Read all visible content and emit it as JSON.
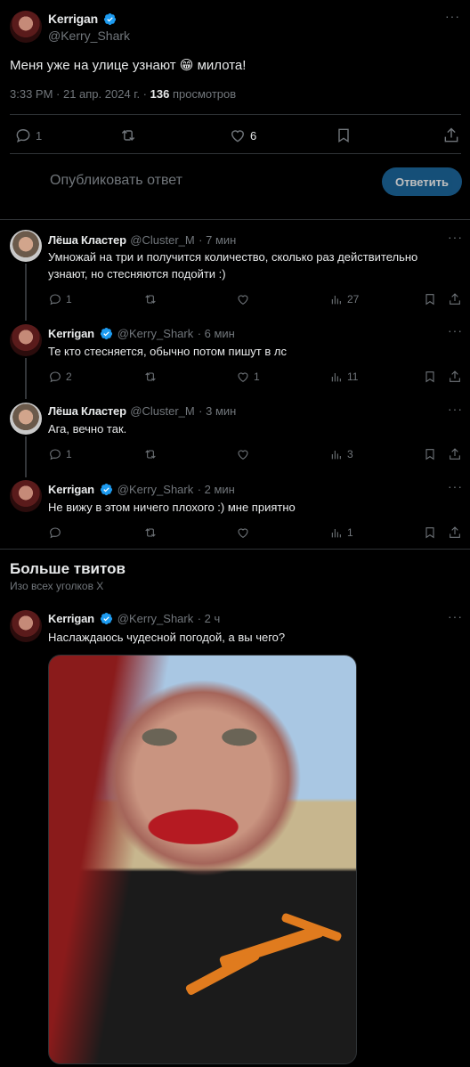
{
  "main_tweet": {
    "author_name": "Kerrigan",
    "author_handle": "@Kerry_Shark",
    "text": "Меня уже на улице узнают 😁 милота!",
    "time": "3:33 PM · 21 апр. 2024 г. · ",
    "views_count": "136",
    "views_label": " просмотров",
    "replies": "1",
    "likes": "6"
  },
  "reply_box": {
    "placeholder": "Опубликовать ответ",
    "button_label": "Ответить"
  },
  "replies": [
    {
      "name": "Лёша Кластер",
      "handle": "@Cluster_M",
      "time": "· 7 мин",
      "text_line1": "Умножай на три и получится количество, сколько раз действительно",
      "text_line2": "узнают, но стесняются подойти :)",
      "replies": "1",
      "retweets": "",
      "likes": "",
      "views": "27",
      "verified": false
    },
    {
      "name": "Kerrigan",
      "handle": "@Kerry_Shark",
      "time": "· 6 мин",
      "text_line1": "Те кто стесняется, обычно потом пишут в лс",
      "text_line2": "",
      "replies": "2",
      "retweets": "",
      "likes": "1",
      "views": "11",
      "verified": true
    },
    {
      "name": "Лёша Кластер",
      "handle": "@Cluster_M",
      "time": "· 3 мин",
      "text_line1": "Ага, вечно так.",
      "text_line2": "",
      "replies": "1",
      "retweets": "",
      "likes": "",
      "views": "3",
      "verified": false
    },
    {
      "name": "Kerrigan",
      "handle": "@Kerry_Shark",
      "time": "· 2 мин",
      "text_line1": "Не вижу в этом ничего плохого :) мне приятно",
      "text_line2": "",
      "replies": "",
      "retweets": "",
      "likes": "",
      "views": "1",
      "verified": true
    }
  ],
  "more_section": {
    "title": "Больше твитов",
    "subtitle": "Изо всех уголков X"
  },
  "more_tweet": {
    "name": "Kerrigan",
    "handle": "@Kerry_Shark",
    "time": "· 2 ч",
    "text": "Наслаждаюсь чудесной погодой, а вы чего?"
  },
  "colors": {
    "background": "#000000",
    "accent": "#1d9bf0",
    "muted": "#71767b",
    "separator": "#2f3336"
  }
}
